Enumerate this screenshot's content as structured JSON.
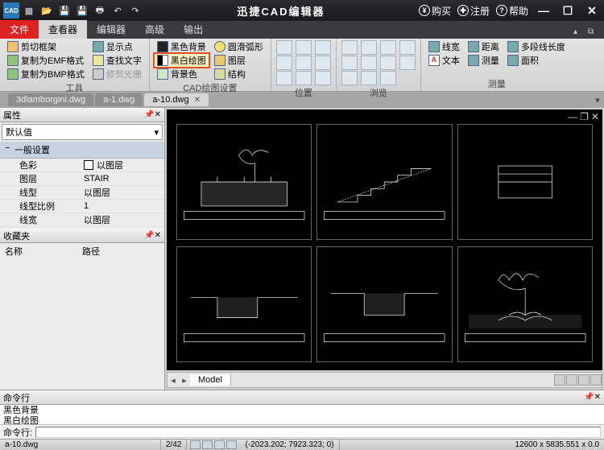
{
  "titlebar": {
    "appTitle": "迅捷CAD编辑器",
    "buy": "购买",
    "register": "注册",
    "help": "帮助",
    "qat": [
      "CAD",
      "new",
      "open",
      "save",
      "saveas",
      "print",
      "undo",
      "redo"
    ]
  },
  "menu": {
    "file": "文件",
    "viewer": "查看器",
    "editor": "编辑器",
    "advanced": "高级",
    "output": "输出"
  },
  "ribbon": {
    "group1_label": "工具",
    "g1_a": "剪切框架",
    "g1_b": "复制为EMF格式",
    "g1_c": "复制为BMP格式",
    "g1_d": "显示点",
    "g1_e": "查找文字",
    "g1_f": "修剪光栅",
    "group2_label": "CAD绘图设置",
    "g2_a": "黑色背景",
    "g2_b": "黑白绘图",
    "g2_c": "背景色",
    "g2_d": "圆滑弧形",
    "g2_e": "图层",
    "g2_f": "结构",
    "group3_label": "位置",
    "group4_label": "浏览",
    "group5_label": "测量",
    "g5_a": "线宽",
    "g5_b": "文本",
    "g5_c": "距离",
    "g5_d": "测量",
    "g5_e": "多段线长度",
    "g5_f": "面积"
  },
  "doctabs": {
    "t1": "3dlamborgini.dwg",
    "t2": "a-1.dwg",
    "t3": "a-10.dwg"
  },
  "props": {
    "panel": "属性",
    "defaultVal": "默认值",
    "section": "一般设置",
    "k1": "色彩",
    "v1": "以图层",
    "k2": "图层",
    "v2": "STAIR",
    "k3": "线型",
    "v3": "以图层",
    "k4": "线型比例",
    "v4": "1",
    "k5": "线宽",
    "v5": "以图层",
    "fav": "收藏夹",
    "favc1": "名称",
    "favc2": "路径"
  },
  "model": {
    "tab": "Model"
  },
  "cmd": {
    "panel": "命令行",
    "log1": "黑色背景",
    "log2": "黑白绘图",
    "prompt": "命令行:"
  },
  "status": {
    "file": "a-10.dwg",
    "pages": "2/42",
    "coords": "(-2023.202; 7923.323; 0)",
    "dims": "12600 x 5835.551 x 0.0"
  }
}
